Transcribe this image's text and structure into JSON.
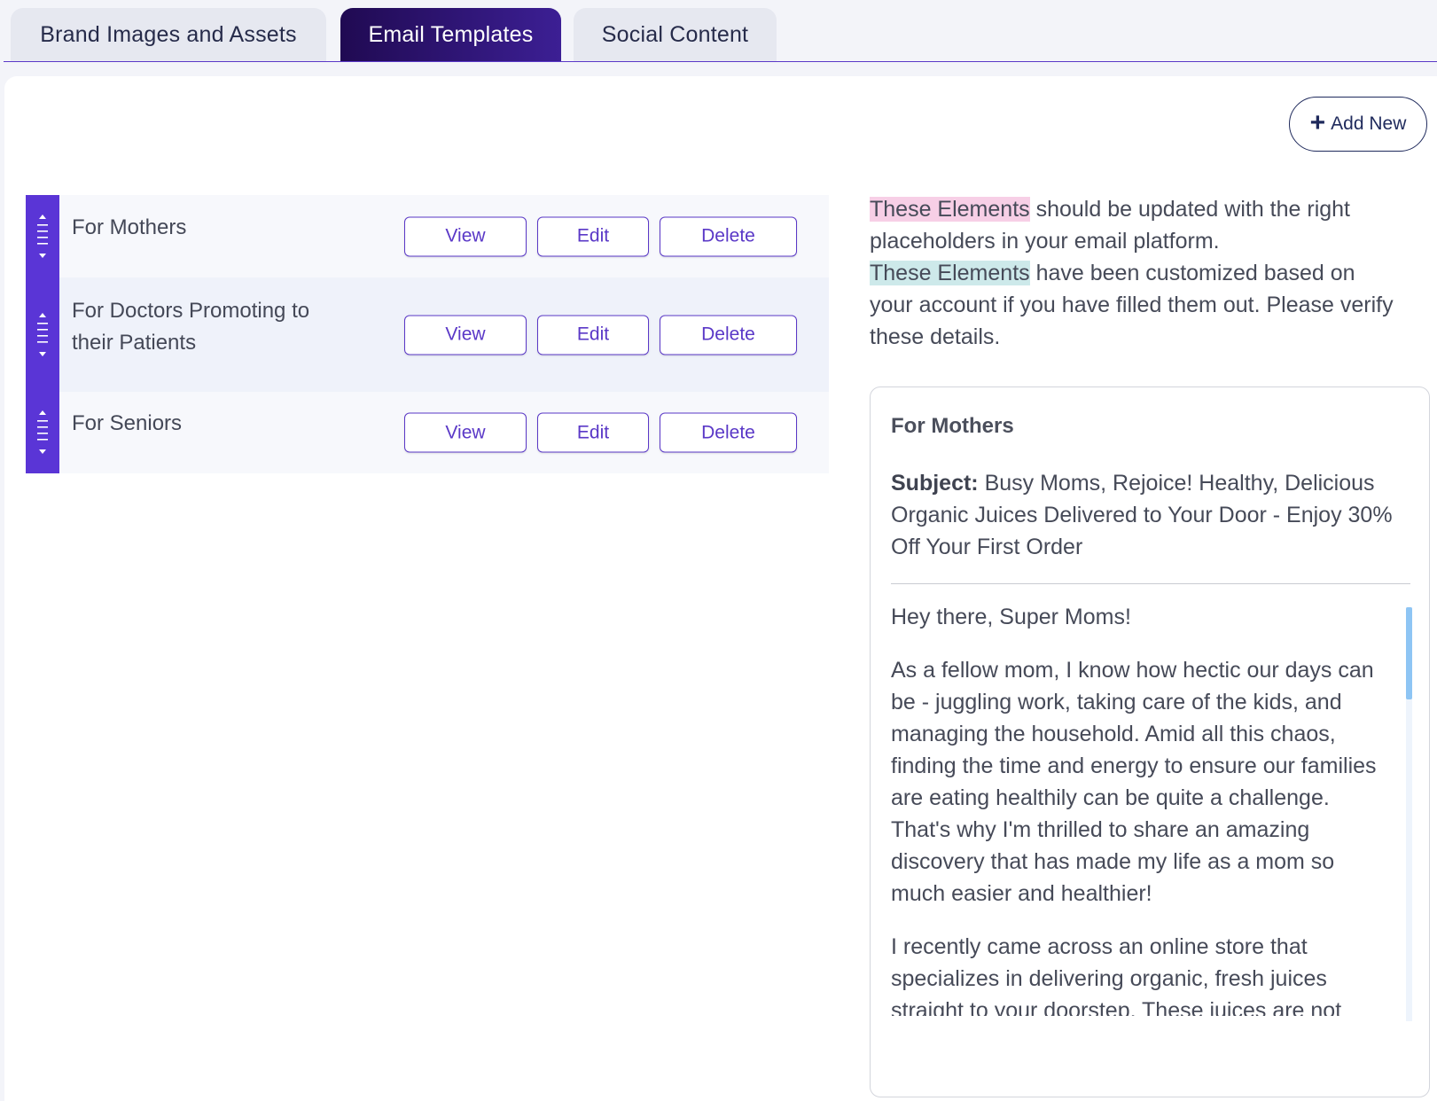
{
  "tabs": [
    {
      "label": "Brand Images and Assets",
      "active": false
    },
    {
      "label": "Email Templates",
      "active": true
    },
    {
      "label": "Social Content",
      "active": false
    }
  ],
  "toolbar": {
    "add_new_label": "Add New"
  },
  "templates": [
    {
      "title": "For Mothers",
      "view": "View",
      "edit": "Edit",
      "delete": "Delete"
    },
    {
      "title": "For Doctors Promoting to their Patients",
      "view": "View",
      "edit": "Edit",
      "delete": "Delete"
    },
    {
      "title": "For Seniors",
      "view": "View",
      "edit": "Edit",
      "delete": "Delete"
    }
  ],
  "info": {
    "placeholder_highlight": "These Elements",
    "placeholder_text": " should be updated with the right placeholders in your email platform.",
    "custom_highlight": "These Elements",
    "custom_text": " have been customized based on your account if you have filled them out. Please verify these details."
  },
  "preview": {
    "title": "For Mothers",
    "subject_label": "Subject:",
    "subject": " Busy Moms, Rejoice! Healthy, Delicious Organic Juices Delivered to Your Door - Enjoy 30% Off Your First Order",
    "body": [
      "Hey there, Super Moms!",
      "As a fellow mom, I know how hectic our days can be - juggling work, taking care of the kids, and managing the household. Amid all this chaos, finding the time and energy to ensure our families are eating healthily can be quite a challenge. That's why I'm thrilled to share an amazing discovery that has made my life as a mom so much easier and healthier!",
      "I recently came across an online store that specializes in delivering organic, fresh juices straight to your doorstep. These juices are not"
    ]
  },
  "colors": {
    "accent": "#5a38c7",
    "active_tab_start": "#200a52",
    "active_tab_end": "#3c1f94",
    "placeholder_highlight": "#f7cfe6",
    "custom_highlight": "#cde9ea",
    "scroll_thumb": "#8ec5f4"
  },
  "icons": {
    "drag_handle": "drag-handle-icon",
    "plus": "plus-icon"
  }
}
